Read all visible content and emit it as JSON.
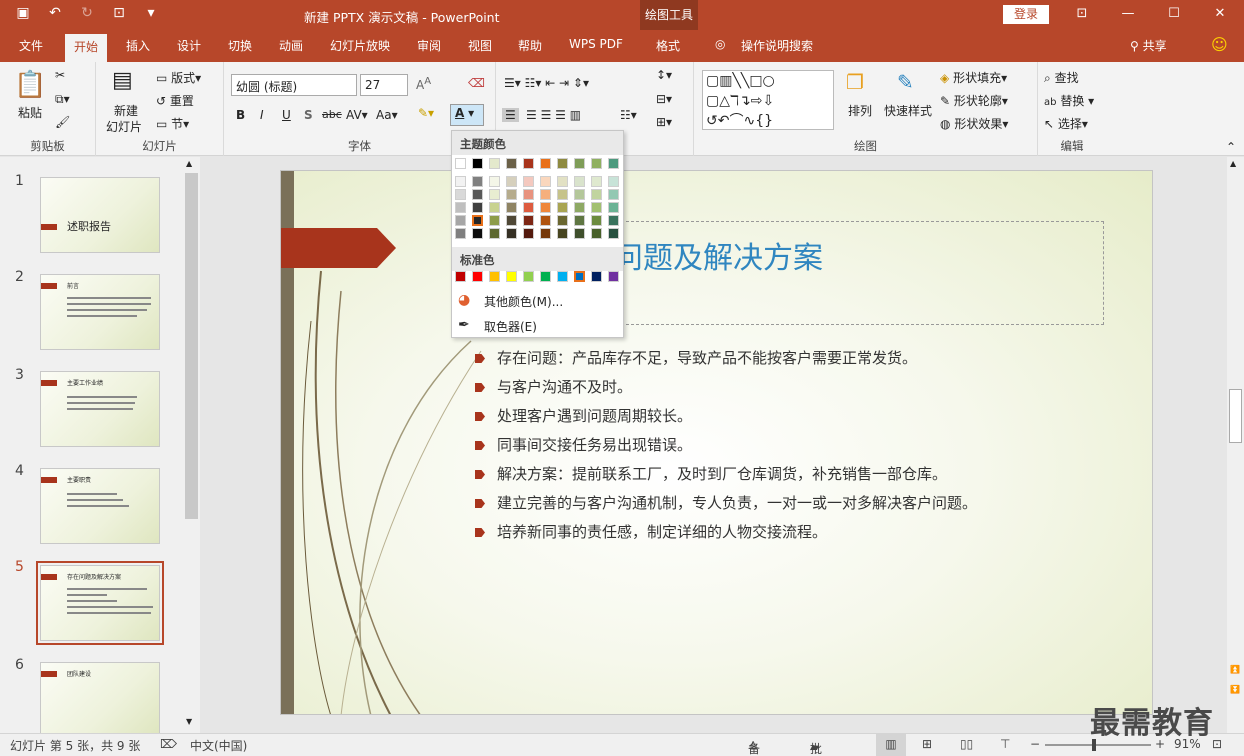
{
  "title": {
    "document": "新建 PPTX 演示文稿 - PowerPoint",
    "context_tab": "绘图工具",
    "login": "登录",
    "share": "共享"
  },
  "tabs": [
    "文件",
    "开始",
    "插入",
    "设计",
    "切换",
    "动画",
    "幻灯片放映",
    "审阅",
    "视图",
    "帮助",
    "WPS PDF",
    "格式"
  ],
  "search_placeholder": "操作说明搜索",
  "ribbon": {
    "clipboard": {
      "paste": "粘贴",
      "label": "剪贴板"
    },
    "slides": {
      "new_slide": "新建",
      "new_slide2": "幻灯片",
      "layout": "版式",
      "reset": "重置",
      "section": "节",
      "label": "幻灯片"
    },
    "font": {
      "name": "幼圆 (标题)",
      "size": "27",
      "bold": "B",
      "italic": "I",
      "underline": "U",
      "shadow": "S",
      "strike": "abc",
      "spacing": "AV",
      "case": "Aa",
      "font_color": "A",
      "label": "字体"
    },
    "paragraph": {
      "label": "段落"
    },
    "drawing": {
      "arrange": "排列",
      "quick_styles": "快速样式",
      "fill": "形状填充",
      "outline": "形状轮廓",
      "effects": "形状效果",
      "label": "绘图"
    },
    "editing": {
      "find": "查找",
      "replace": "替换",
      "select": "选择",
      "label": "编辑"
    }
  },
  "thumbnails": [
    {
      "num": "1",
      "title": "述职报告"
    },
    {
      "num": "2",
      "title": "前言"
    },
    {
      "num": "3",
      "title": "主要工作业绩"
    },
    {
      "num": "4",
      "title": "主要职责"
    },
    {
      "num": "5",
      "title": "存在问题及解决方案"
    },
    {
      "num": "6",
      "title": "团队建设"
    }
  ],
  "slide": {
    "title": "问题及解决方案",
    "bullets": [
      "存在问题：产品库存不足，导致产品不能按客户需要正常发货。",
      "与客户沟通不及时。",
      "处理客户遇到问题周期较长。",
      "同事间交接任务易出现错误。",
      "解决方案：提前联系工厂，及时到厂仓库调货，补充销售一部仓库。",
      "建立完善的与客户沟通机制，专人负责，一对一或一对多解决客户问题。",
      "培养新同事的责任感，制定详细的人物交接流程。"
    ]
  },
  "color_popup": {
    "theme_header": "主题颜色",
    "standard_header": "标准色",
    "more_colors": "其他颜色(M)...",
    "eyedropper": "取色器(E)",
    "theme_top": [
      "#ffffff",
      "#000000",
      "#e4e9cc",
      "#6b6148",
      "#a8341c",
      "#e8701a",
      "#8e8a40",
      "#7f9d58",
      "#90b060",
      "#4d9a7e"
    ],
    "theme_tints": [
      [
        "#f2f2f2",
        "#808080",
        "#f4f6e8",
        "#d6d0bd",
        "#f4c9bf",
        "#fad7bd",
        "#e2e1c4",
        "#d9e3cc",
        "#dfe9cf",
        "#c8e3d8"
      ],
      [
        "#d9d9d9",
        "#595959",
        "#e8edd1",
        "#b6ac8d",
        "#e8937f",
        "#f5af7c",
        "#c6c38a",
        "#b4c79a",
        "#c1d49f",
        "#93c8b2"
      ],
      [
        "#bfbfbf",
        "#404040",
        "#c8d28f",
        "#8f8463",
        "#dd5b3f",
        "#ef873b",
        "#a9a552",
        "#8ea964",
        "#a2c070",
        "#6bb395"
      ],
      [
        "#a6a6a6",
        "#262626",
        "#8d9c49",
        "#4f4836",
        "#7e2715",
        "#b05410",
        "#6a6730",
        "#5f7642",
        "#6c8b3f",
        "#3a735e"
      ],
      [
        "#7f7f7f",
        "#0d0d0d",
        "#5d6830",
        "#353024",
        "#541a0e",
        "#753809",
        "#474520",
        "#3f4f2c",
        "#48602a",
        "#27503f"
      ]
    ],
    "standard": [
      "#c00000",
      "#ff0000",
      "#ffc000",
      "#ffff00",
      "#92d050",
      "#00b050",
      "#00b0f0",
      "#0070c0",
      "#002060",
      "#7030a0"
    ]
  },
  "status": {
    "slide_info": "幻灯片 第 5 张，共 9 张",
    "language": "中文(中国)",
    "notes": "备注",
    "comments": "批注",
    "zoom": "91%"
  },
  "watermark": "最需教育"
}
